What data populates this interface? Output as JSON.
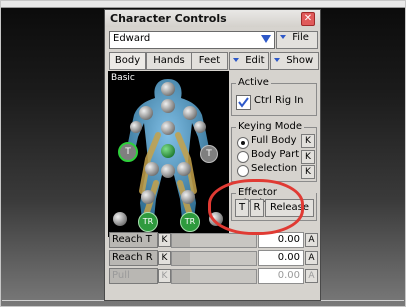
{
  "window": {
    "title": "Character Controls",
    "close_glyph": "✕"
  },
  "character": {
    "selected": "Edward"
  },
  "file_menu": {
    "label": "File"
  },
  "tabs": [
    "Body",
    "Hands",
    "Feet"
  ],
  "edit_menu": {
    "label": "Edit"
  },
  "show_menu": {
    "label": "Show"
  },
  "figure": {
    "label": "Basic",
    "badges": {
      "t": "T",
      "tr": "TR"
    }
  },
  "active_group": {
    "title": "Active",
    "ctrl_rig_label": "Ctrl Rig In",
    "checked": true
  },
  "keying_mode": {
    "title": "Keying Mode",
    "options": [
      {
        "label": "Full Body",
        "selected": true
      },
      {
        "label": "Body Part",
        "selected": false
      },
      {
        "label": "Selection",
        "selected": false
      }
    ],
    "k_label": "K"
  },
  "effector_pinning": {
    "title": "Effector Pinning",
    "t": "T",
    "r": "R",
    "release": "Release"
  },
  "rows": [
    {
      "label": "Reach T",
      "k": "K",
      "value": "0.00",
      "a": "A",
      "enabled": true
    },
    {
      "label": "Reach R",
      "k": "K",
      "value": "0.00",
      "a": "A",
      "enabled": true
    },
    {
      "label": "Pull",
      "k": "K",
      "value": "0.00",
      "a": "A",
      "enabled": false
    }
  ],
  "colors": {
    "accent_blue": "#2d58c8",
    "highlight_red": "#e03a33",
    "effector_green": "#2e9a3d",
    "effector_gray": "#7f7f7f"
  }
}
